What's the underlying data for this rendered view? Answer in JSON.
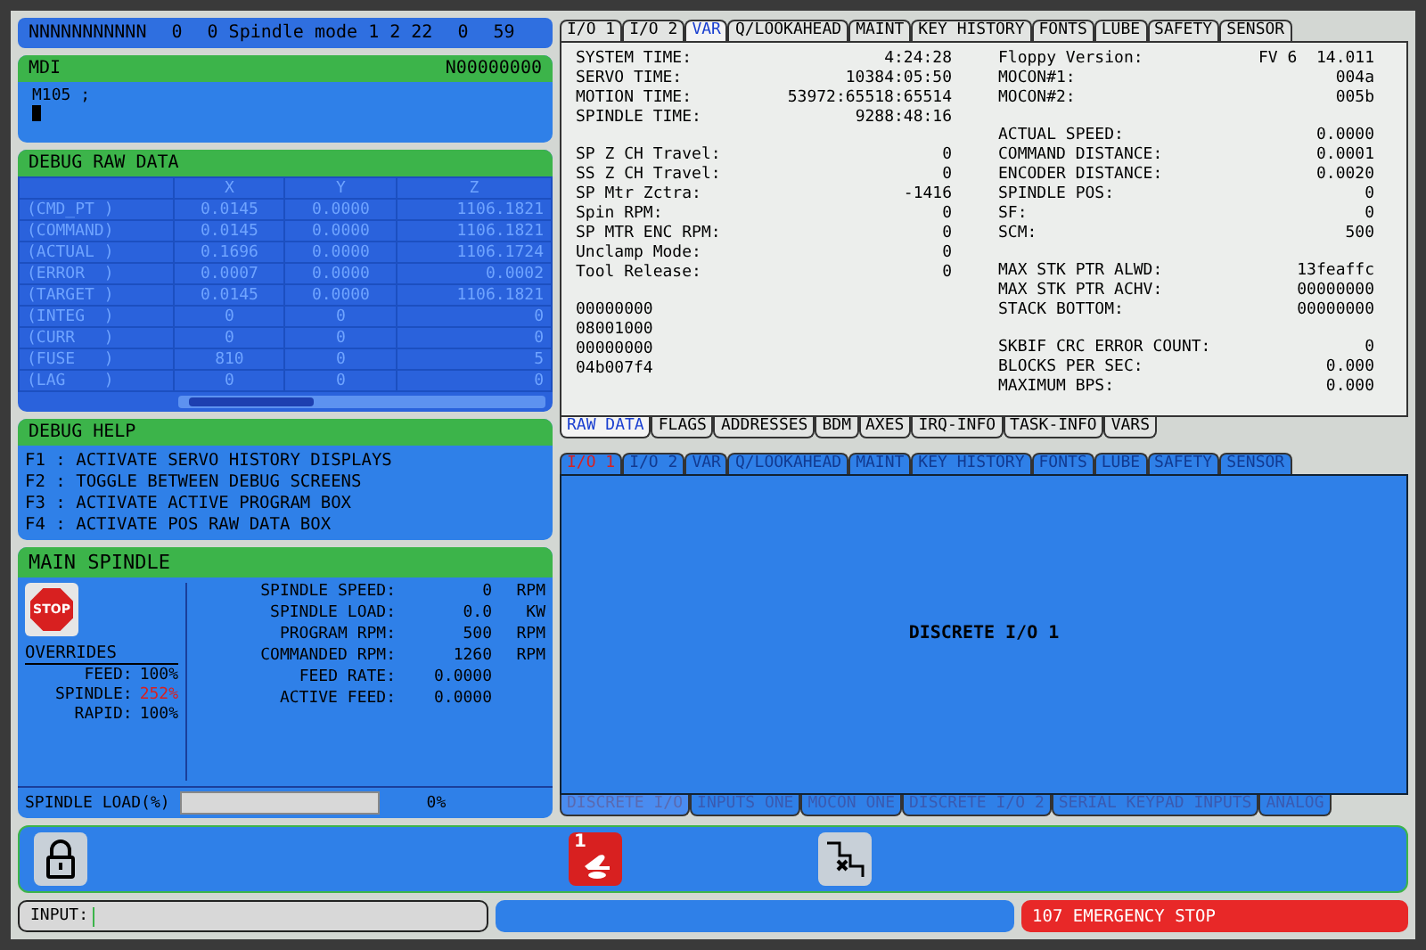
{
  "status_bar": {
    "items": [
      "NNNNNNNNNNN",
      "0",
      "0 Spindle mode 1 2 22",
      "0",
      "59"
    ]
  },
  "mdi": {
    "title": "MDI",
    "sequence": "N00000000",
    "program_line": "M105 ;"
  },
  "debug_raw_data": {
    "title": "DEBUG RAW DATA",
    "columns": [
      "X",
      "Y",
      "Z"
    ],
    "rows": [
      {
        "label": "(CMD_PT )",
        "values": [
          "0.0145",
          "0.0000",
          "1106.1821"
        ]
      },
      {
        "label": "(COMMAND)",
        "values": [
          "0.0145",
          "0.0000",
          "1106.1821"
        ]
      },
      {
        "label": "(ACTUAL )",
        "values": [
          "0.1696",
          "0.0000",
          "1106.1724"
        ]
      },
      {
        "label": "(ERROR  )",
        "values": [
          "0.0007",
          "0.0000",
          "0.0002"
        ]
      },
      {
        "label": "(TARGET )",
        "values": [
          "0.0145",
          "0.0000",
          "1106.1821"
        ]
      },
      {
        "label": "(INTEG  )",
        "values": [
          "0",
          "0",
          "0"
        ]
      },
      {
        "label": "(CURR   )",
        "values": [
          "0",
          "0",
          "0"
        ]
      },
      {
        "label": "(FUSE   )",
        "values": [
          "810",
          "0",
          "5"
        ]
      },
      {
        "label": "(LAG    )",
        "values": [
          "0",
          "0",
          "0"
        ]
      }
    ]
  },
  "debug_help": {
    "title": "DEBUG HELP",
    "lines": [
      "F1 : ACTIVATE SERVO HISTORY DISPLAYS",
      "F2 : TOGGLE BETWEEN DEBUG SCREENS",
      "F3 : ACTIVATE ACTIVE PROGRAM BOX",
      "F4 : ACTIVATE POS RAW DATA BOX"
    ]
  },
  "main_spindle": {
    "title": "MAIN SPINDLE",
    "stop_label": "STOP",
    "overrides_title": "OVERRIDES",
    "overrides": [
      {
        "label": "FEED:",
        "value": "100%",
        "warning": false
      },
      {
        "label": "SPINDLE:",
        "value": "252%",
        "warning": true
      },
      {
        "label": "RAPID:",
        "value": "100%",
        "warning": false
      }
    ],
    "readings": [
      {
        "label": "SPINDLE SPEED:",
        "value": "0",
        "unit": "RPM"
      },
      {
        "label": "SPINDLE LOAD:",
        "value": "0.0",
        "unit": "KW"
      },
      {
        "label": "PROGRAM RPM:",
        "value": "500",
        "unit": "RPM"
      },
      {
        "label": "COMMANDED RPM:",
        "value": "1260",
        "unit": "RPM"
      },
      {
        "label": "FEED RATE:",
        "value": "0.0000"
      },
      {
        "label": "ACTIVE FEED:",
        "value": "0.0000"
      }
    ],
    "load": {
      "label": "SPINDLE LOAD(%)",
      "level": 0,
      "reading": "0%"
    }
  },
  "diagnostic_panel": {
    "tabs": [
      {
        "label": "I/O 1",
        "selected": false
      },
      {
        "label": "I/O 2",
        "selected": false
      },
      {
        "label": "VAR",
        "selected": true
      },
      {
        "label": "Q/LOOKAHEAD",
        "selected": false
      },
      {
        "label": "MAINT",
        "selected": false
      },
      {
        "label": "KEY HISTORY",
        "selected": false
      },
      {
        "label": "FONTS",
        "selected": false
      },
      {
        "label": "LUBE",
        "selected": false
      },
      {
        "label": "SAFETY",
        "selected": false
      },
      {
        "label": "SENSOR",
        "selected": false
      }
    ],
    "left_groups": [
      [
        {
          "label": "SYSTEM TIME:",
          "value": "4:24:28"
        },
        {
          "label": "SERVO TIME:",
          "value": "10384:05:50"
        },
        {
          "label": "MOTION TIME:",
          "value": "53972:65518:65514"
        },
        {
          "label": "SPINDLE TIME:",
          "value": "9288:48:16"
        }
      ],
      [
        {
          "label": "SP Z CH Travel:",
          "value": "0"
        },
        {
          "label": "SS Z CH Travel:",
          "value": "0"
        },
        {
          "label": "SP Mtr Zctra:",
          "value": "-1416"
        },
        {
          "label": "Spin RPM:",
          "value": "0"
        },
        {
          "label": "SP MTR ENC RPM:",
          "value": "0"
        },
        {
          "label": "Unclamp Mode:",
          "value": "0"
        },
        {
          "label": "Tool Release:",
          "value": "0"
        }
      ],
      [
        {
          "value": "00000000"
        },
        {
          "value": "08001000"
        },
        {
          "value": "00000000"
        },
        {
          "value": "04b007f4"
        }
      ]
    ],
    "right_groups": [
      [
        {
          "label": "Floppy Version:",
          "value": "FV 6  14.011"
        },
        {
          "label": "MOCON#1:",
          "value": "004a"
        },
        {
          "label": "MOCON#2:",
          "value": "005b"
        }
      ],
      [
        {
          "label": "ACTUAL SPEED:",
          "value": "0.0000"
        },
        {
          "label": "COMMAND DISTANCE:",
          "value": "0.0001"
        },
        {
          "label": "ENCODER DISTANCE:",
          "value": "0.0020"
        },
        {
          "label": "SPINDLE POS:",
          "value": "0"
        },
        {
          "label": "SF:",
          "value": "0"
        },
        {
          "label": "SCM:",
          "value": "500"
        }
      ],
      [
        {
          "label": "MAX STK PTR ALWD:",
          "value": "13feaffc"
        },
        {
          "label": "MAX STK PTR ACHV:",
          "value": "00000000"
        },
        {
          "label": "STACK BOTTOM:",
          "value": "00000000"
        }
      ],
      [
        {
          "label": "SKBIF CRC ERROR COUNT:",
          "value": "0"
        },
        {
          "label": "BLOCKS PER SEC:",
          "value": "0.000"
        },
        {
          "label": "MAXIMUM BPS:",
          "value": "0.000"
        }
      ]
    ],
    "subtabs": [
      {
        "label": "RAW DATA",
        "selected": true
      },
      {
        "label": "FLAGS",
        "selected": false
      },
      {
        "label": "ADDRESSES",
        "selected": false
      },
      {
        "label": "BDM",
        "selected": false
      },
      {
        "label": "AXES",
        "selected": false
      },
      {
        "label": "IRQ-INFO",
        "selected": false
      },
      {
        "label": "TASK-INFO",
        "selected": false
      },
      {
        "label": "VARS",
        "selected": false
      }
    ]
  },
  "io_panel": {
    "tabs": [
      {
        "label": "I/O 1",
        "selected": true
      },
      {
        "label": "I/O 2",
        "selected": false
      },
      {
        "label": "VAR",
        "selected": false
      },
      {
        "label": "Q/LOOKAHEAD",
        "selected": false
      },
      {
        "label": "MAINT",
        "selected": false
      },
      {
        "label": "KEY HISTORY",
        "selected": false
      },
      {
        "label": "FONTS",
        "selected": false
      },
      {
        "label": "LUBE",
        "selected": false
      },
      {
        "label": "SAFETY",
        "selected": false
      },
      {
        "label": "SENSOR",
        "selected": false
      }
    ],
    "content_title": "DISCRETE I/O 1",
    "subtabs": [
      {
        "label": "DISCRETE I/O",
        "selected": true
      },
      {
        "label": "INPUTS ONE",
        "selected": false
      },
      {
        "label": "MOCON ONE",
        "selected": false
      },
      {
        "label": "DISCRETE I/O 2",
        "selected": false
      },
      {
        "label": "SERIAL KEYPAD INPUTS",
        "selected": false
      },
      {
        "label": "ANALOG",
        "selected": false
      }
    ]
  },
  "toolbar": {
    "handle_jog_number": "1"
  },
  "input": {
    "label": "INPUT:"
  },
  "alarm": {
    "text": "107 EMERGENCY STOP"
  }
}
